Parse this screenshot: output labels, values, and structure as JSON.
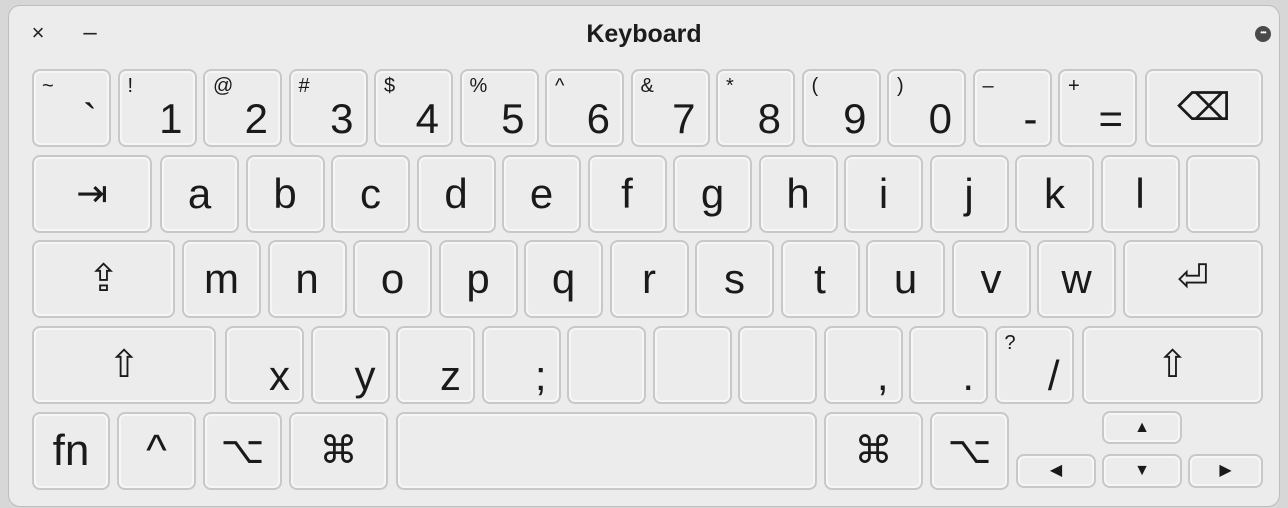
{
  "window": {
    "title": "Keyboard",
    "close_glyph": "×",
    "minimize_glyph": "–",
    "more_glyph": "•••"
  },
  "keyboard": {
    "row1": [
      {
        "sec": "~",
        "main": "`"
      },
      {
        "sec": "!",
        "main": "1"
      },
      {
        "sec": "@",
        "main": "2"
      },
      {
        "sec": "#",
        "main": "3"
      },
      {
        "sec": "$",
        "main": "4"
      },
      {
        "sec": "%",
        "main": "5"
      },
      {
        "sec": "^",
        "main": "6"
      },
      {
        "sec": "&",
        "main": "7"
      },
      {
        "sec": "*",
        "main": "8"
      },
      {
        "sec": "(",
        "main": "9"
      },
      {
        "sec": ")",
        "main": "0"
      },
      {
        "sec": "–",
        "main": "-"
      },
      {
        "sec": "+",
        "main": "="
      }
    ],
    "delete_icon": "⌫",
    "tab_icon": "⇥",
    "row2": [
      "a",
      "b",
      "c",
      "d",
      "e",
      "f",
      "g",
      "h",
      "i",
      "j",
      "k",
      "l",
      ""
    ],
    "caps_icon": "⇪",
    "row3": [
      "m",
      "n",
      "o",
      "p",
      "q",
      "r",
      "s",
      "t",
      "u",
      "v",
      "w"
    ],
    "return_icon": "⏎",
    "shift_icon": "⇧",
    "row4": [
      {
        "sec": "",
        "main": "x"
      },
      {
        "sec": "",
        "main": "y"
      },
      {
        "sec": "",
        "main": "z"
      },
      {
        "sec": "",
        "main": ";"
      },
      {
        "sec": "",
        "main": ""
      },
      {
        "sec": "",
        "main": ""
      },
      {
        "sec": "",
        "main": ""
      },
      {
        "sec": "",
        "main": ","
      },
      {
        "sec": "",
        "main": "."
      },
      {
        "sec": "?",
        "main": "/"
      }
    ],
    "fn_label": "fn",
    "control_icon": "^",
    "option_icon": "⌥",
    "command_icon": "⌘",
    "space_label": "",
    "arrow_up": "▲",
    "arrow_left": "◀",
    "arrow_down": "▼",
    "arrow_right": "▶"
  }
}
